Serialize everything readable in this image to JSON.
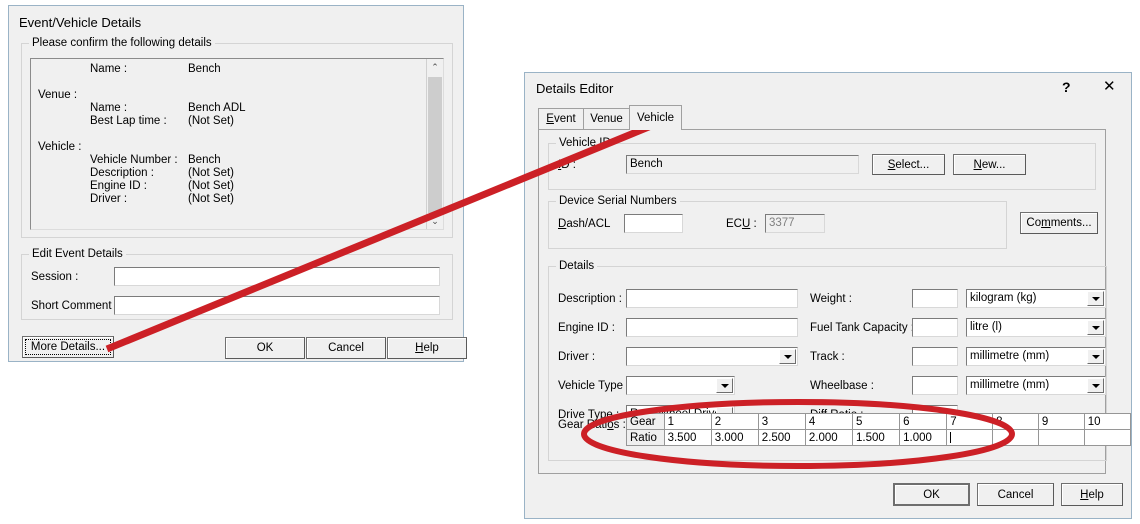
{
  "left_dialog": {
    "title": "Event/Vehicle Details",
    "confirm_group": {
      "caption": "Please confirm the following details"
    },
    "details_text": {
      "rows": [
        {
          "indent": 1,
          "label": "Name :",
          "value": "Bench"
        },
        {
          "indent": 0,
          "label": "",
          "value": ""
        },
        {
          "indent": 0,
          "label": "Venue :",
          "value": ""
        },
        {
          "indent": 1,
          "label": "Name :",
          "value": "Bench ADL"
        },
        {
          "indent": 1,
          "label": "Best Lap time :",
          "value": "(Not Set)"
        },
        {
          "indent": 0,
          "label": "",
          "value": ""
        },
        {
          "indent": 0,
          "label": "Vehicle :",
          "value": ""
        },
        {
          "indent": 1,
          "label": "Vehicle Number :",
          "value": "Bench"
        },
        {
          "indent": 1,
          "label": "Description :",
          "value": "(Not Set)"
        },
        {
          "indent": 1,
          "label": "Engine ID :",
          "value": "(Not Set)"
        },
        {
          "indent": 1,
          "label": "Driver :",
          "value": "(Not Set)"
        }
      ]
    },
    "scrollbar": {
      "up_glyph": "⌃",
      "down_glyph": "⌄"
    },
    "edit_group": {
      "caption": "Edit Event Details"
    },
    "session": {
      "label": "Session :",
      "value": "",
      "placeholder": ""
    },
    "short_comment": {
      "label": "Short Comment :",
      "value": "",
      "placeholder": ""
    },
    "buttons": {
      "more_details": "More Details...",
      "ok": "OK",
      "cancel": "Cancel",
      "help": "Help"
    }
  },
  "right_dialog": {
    "title": "Details Editor",
    "titlebar": {
      "help_glyph": "?",
      "close_glyph": "✕"
    },
    "tabs": [
      {
        "label": "Event",
        "selected": false
      },
      {
        "label": "Venue",
        "selected": false
      },
      {
        "label": "Vehicle",
        "selected": true
      }
    ],
    "vehicle_id_group": {
      "caption": "Vehicle ID",
      "id_label": "ID :",
      "id_value": "Bench",
      "select_button": "Select...",
      "new_button": "New..."
    },
    "device_group": {
      "caption": "Device Serial Numbers",
      "dash_label": "Dash/ACL",
      "dash_value": "",
      "ecu_label": "ECU :",
      "ecu_value": "3377"
    },
    "comments_button": "Comments...",
    "details_group": {
      "caption": "Details",
      "left_fields": [
        {
          "label": "Description :",
          "value": "",
          "type": "text"
        },
        {
          "label": "Engine ID :",
          "value": "",
          "type": "text"
        },
        {
          "label": "Driver :",
          "value": "",
          "type": "combo"
        },
        {
          "label": "Vehicle Type :",
          "value": "",
          "type": "combo"
        },
        {
          "label": "Drive Type :",
          "value": "Rear Wheel Drive",
          "type": "combo"
        }
      ],
      "right_fields": [
        {
          "label": "Weight :",
          "value": "",
          "unit": "kilogram (kg)"
        },
        {
          "label": "Fuel Tank Capacity :",
          "value": "",
          "unit": "litre (l)"
        },
        {
          "label": "Track :",
          "value": "",
          "unit": "millimetre (mm)"
        },
        {
          "label": "Wheelbase :",
          "value": "",
          "unit": "millimetre (mm)"
        },
        {
          "label": "Diff Ratio :",
          "value": "",
          "unit": ""
        }
      ],
      "gear_ratios": {
        "label": "Gear Ratios :",
        "row_headers": [
          "Gear",
          "Ratio"
        ],
        "gears": [
          "1",
          "2",
          "3",
          "4",
          "5",
          "6",
          "7",
          "8",
          "9",
          "10"
        ],
        "ratios": [
          "3.500",
          "3.000",
          "2.500",
          "2.000",
          "1.500",
          "1.000",
          "",
          "",
          "",
          ""
        ],
        "focused_cell_index": 6
      }
    },
    "buttons": {
      "ok": "OK",
      "cancel": "Cancel",
      "help": "Help"
    }
  },
  "annotations": {
    "arrow_color": "#cc2026",
    "ellipse_color": "#cc2026",
    "arrow_from": "more-details-button",
    "arrow_to": "vehicle-tab",
    "ellipse_target": "gear-ratios-grid"
  }
}
